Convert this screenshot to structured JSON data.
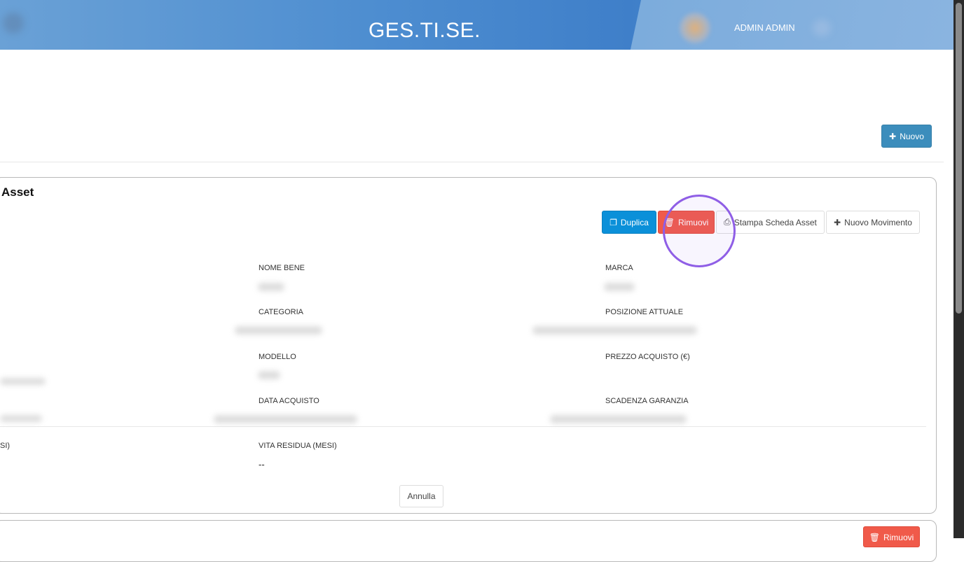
{
  "header": {
    "title": "GES.TI.SE.",
    "user_name": "ADMIN ADMIN"
  },
  "toolbar": {
    "new_label": "Nuovo"
  },
  "panel": {
    "title": "Asset",
    "actions": {
      "duplicate": "Duplica",
      "remove": "Rimuovi",
      "print": "Stampa Scheda Asset",
      "new_movement": "Nuovo Movimento"
    },
    "fields": {
      "nome_bene": "NOME BENE",
      "marca": "MARCA",
      "categoria": "CATEGORIA",
      "posizione_attuale": "POSIZIONE ATTUALE",
      "modello": "MODELLO",
      "prezzo_acquisto": "PREZZO ACQUISTO (€)",
      "data_acquisto": "DATA ACQUISTO",
      "scadenza_garanzia": "SCADENZA GARANZIA",
      "partial_left": "SI)",
      "vita_residua": "VITA RESIDUA (MESI)",
      "vita_residua_value": "--"
    },
    "cancel": "Annulla"
  },
  "panel2": {
    "remove": "Rimuovi"
  },
  "colors": {
    "primary": "#3c8dbc",
    "info": "#0b90d9",
    "danger": "#f05a4a",
    "click_ring": "#8f5ee6"
  }
}
